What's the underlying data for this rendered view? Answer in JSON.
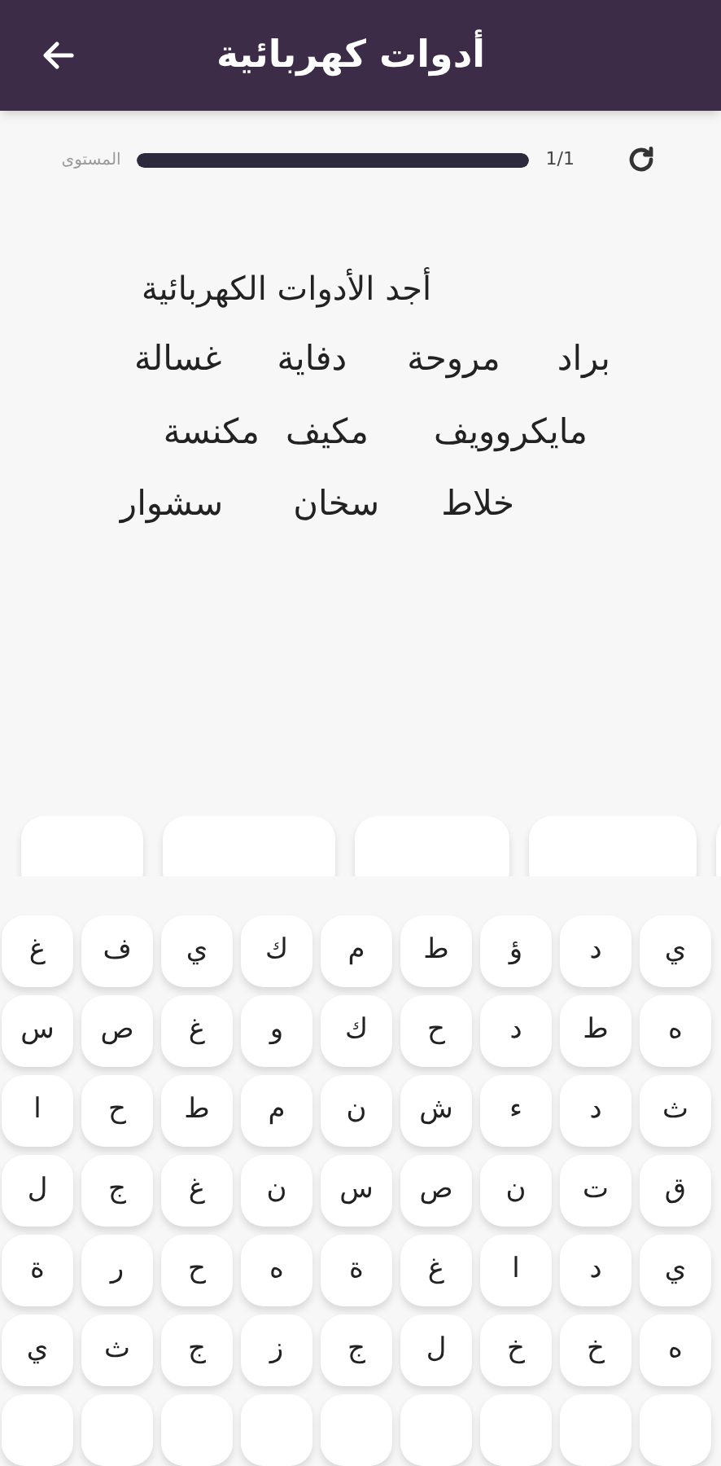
{
  "header": {
    "title": "أدوات كهربائية"
  },
  "progress": {
    "label": "المستوى",
    "level": 1,
    "count": "1/1"
  },
  "puzzle": {
    "prompt": "أجد الأدوات الكهربائية",
    "word_rows": [
      [
        "براد",
        "مروحة",
        "دفاية",
        "غسالة"
      ],
      [
        "مايكروويف",
        "مكيف",
        "مكنسة"
      ],
      [
        "خلاط",
        "سخان",
        "سشوار"
      ]
    ]
  },
  "letter_grid": [
    [
      "ي",
      "د",
      "ؤ",
      "ط",
      "م",
      "ك",
      "ي",
      "ف",
      "غ"
    ],
    [
      "ه",
      "ط",
      "د",
      "ح",
      "ك",
      "و",
      "غ",
      "ص",
      "س"
    ],
    [
      "ث",
      "د",
      "ء",
      "ش",
      "ن",
      "م",
      "ط",
      "ح",
      "ا"
    ],
    [
      "ق",
      "ت",
      "ن",
      "ص",
      "س",
      "ن",
      "غ",
      "ج",
      "ل"
    ],
    [
      "ي",
      "د",
      "ا",
      "غ",
      "ة",
      "ه",
      "ح",
      "ر",
      "ة"
    ],
    [
      "ه",
      "خ",
      "خ",
      "ل",
      "ج",
      "ز",
      "ج",
      "ث",
      "ي"
    ]
  ]
}
